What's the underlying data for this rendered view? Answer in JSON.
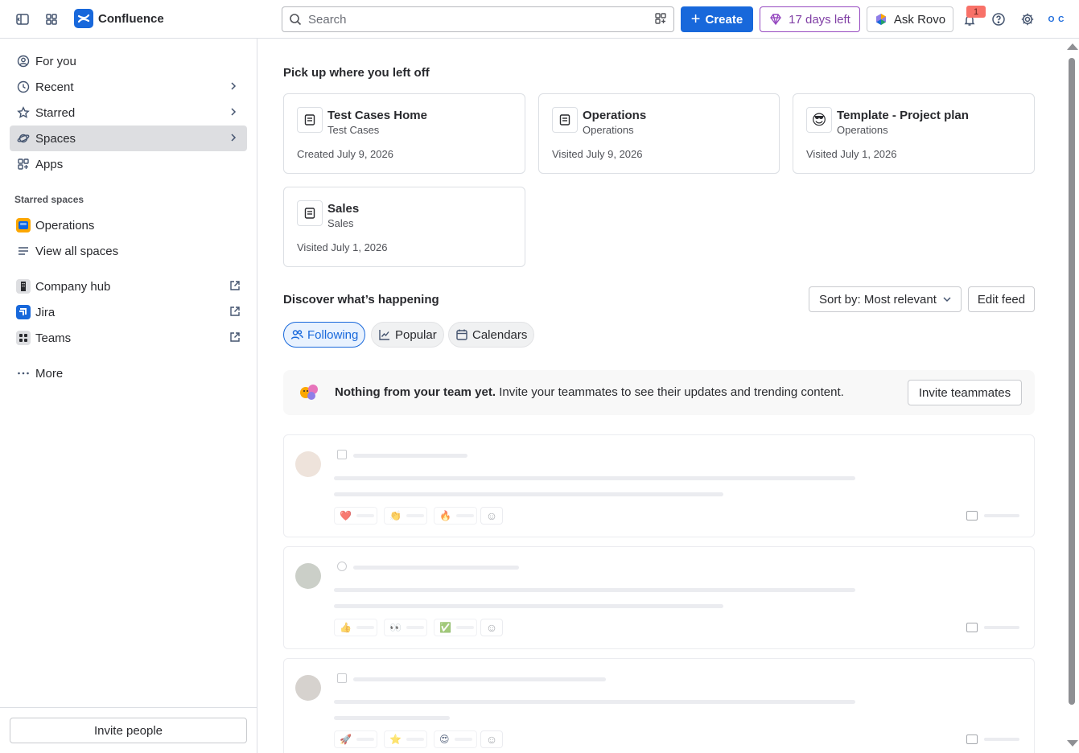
{
  "topbar": {
    "brand": "Confluence",
    "search_placeholder": "Search",
    "create_label": "Create",
    "trial_label": "17 days left",
    "rovo_label": "Ask Rovo",
    "notification_count": "1",
    "org_initials": "O C"
  },
  "sidebar": {
    "items": [
      {
        "label": "For you"
      },
      {
        "label": "Recent"
      },
      {
        "label": "Starred"
      },
      {
        "label": "Spaces"
      },
      {
        "label": "Apps"
      }
    ],
    "starred_spaces_label": "Starred spaces",
    "starred_spaces": [
      {
        "label": "Operations"
      }
    ],
    "view_all_spaces": "View all spaces",
    "external_links": [
      {
        "label": "Company hub"
      },
      {
        "label": "Jira"
      },
      {
        "label": "Teams"
      }
    ],
    "more_label": "More",
    "invite_label": "Invite people"
  },
  "main": {
    "recent_heading": "Pick up where you left off",
    "cards": [
      {
        "title": "Test Cases Home",
        "space": "Test Cases",
        "meta": "Created July 9, 2026",
        "icon": "page-icon"
      },
      {
        "title": "Operations",
        "space": "Operations",
        "meta": "Visited July 9, 2026",
        "icon": "page-icon"
      },
      {
        "title": "Template - Project plan",
        "space": "Operations",
        "meta": "Visited July 1, 2026",
        "icon": "sunglasses-emoji-icon"
      },
      {
        "title": "Sales",
        "space": "Sales",
        "meta": "Visited July 1, 2026",
        "icon": "page-icon"
      }
    ],
    "discover_heading": "Discover what’s happening",
    "sort_label": "Sort by: Most relevant",
    "edit_feed_label": "Edit feed",
    "tabs": [
      {
        "label": "Following",
        "selected": true
      },
      {
        "label": "Popular",
        "selected": false
      },
      {
        "label": "Calendars",
        "selected": false
      }
    ],
    "banner": {
      "bold": "Nothing from your team yet.",
      "text": " Invite your teammates to see their updates and trending content.",
      "button": "Invite teammates"
    },
    "feed_placeholders": [
      {
        "reactions": [
          "❤️",
          "👏",
          "🔥"
        ]
      },
      {
        "reactions": [
          "👍",
          "👀",
          "✅"
        ]
      },
      {
        "reactions": [
          "🚀",
          "⭐",
          "😍"
        ]
      }
    ]
  },
  "colors": {
    "brand_blue": "#1868db",
    "trial_purple": "#803fa5",
    "badge_red": "#f87168",
    "selected_nav_bg": "#dddee1"
  }
}
